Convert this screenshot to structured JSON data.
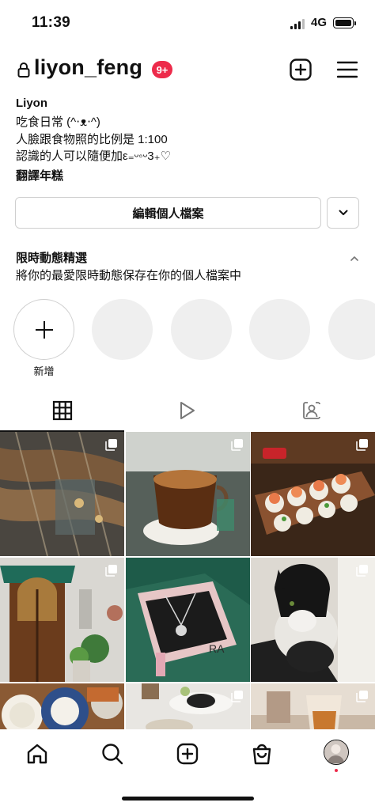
{
  "status_bar": {
    "time": "11:39",
    "network": "4G"
  },
  "header": {
    "username": "liyon_feng",
    "notification_badge": "9+",
    "icons": [
      "lock-icon",
      "new-post-icon",
      "menu-icon"
    ]
  },
  "bio": {
    "name": "Liyon",
    "lines": [
      "吃食日常 (^‧ᴥ‧^)",
      "人臉跟食物照的比例是 1:100",
      "認識的人可以隨便加ε₌ᵕ◦ᵕ3₊♡"
    ],
    "translate_link": "翻譯年糕"
  },
  "actions": {
    "edit_profile_label": "編輯個人檔案"
  },
  "highlights": {
    "title": "限時動態精選",
    "subtitle": "將你的最愛限時動態保存在你的個人檔案中",
    "new_label": "新增"
  },
  "tabs": [
    {
      "name": "posts-grid",
      "icon": "grid-icon",
      "selected": true
    },
    {
      "name": "reels",
      "icon": "reels-icon",
      "selected": false
    },
    {
      "name": "tagged",
      "icon": "tagged-icon",
      "selected": false
    }
  ],
  "posts": [
    {
      "subject": "ornate metal stairs",
      "multi": true
    },
    {
      "subject": "coffee cup",
      "multi": true
    },
    {
      "subject": "sushi rolls",
      "multi": true
    },
    {
      "subject": "wooden door with awning",
      "multi": true
    },
    {
      "subject": "necklace in gift box",
      "multi": false
    },
    {
      "subject": "black and white cat",
      "multi": true
    },
    {
      "subject": "food on table",
      "multi": false
    },
    {
      "subject": "tea set",
      "multi": true
    },
    {
      "subject": "drink glass",
      "multi": true
    }
  ],
  "bottom_nav": {
    "icons": [
      "home-icon",
      "search-icon",
      "create-icon",
      "shop-icon",
      "profile-avatar"
    ]
  },
  "colors": {
    "accent_red": "#ed2b4b",
    "border": "#cfcfcf",
    "placeholder": "#efefef"
  }
}
